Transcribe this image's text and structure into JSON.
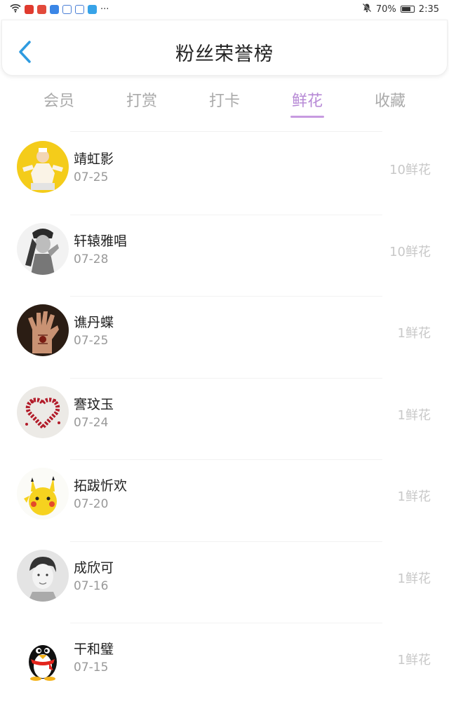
{
  "status_bar": {
    "battery": "70%",
    "time": "2:35",
    "dots": "···"
  },
  "header": {
    "title": "粉丝荣誉榜"
  },
  "tabs": [
    {
      "label": "会员"
    },
    {
      "label": "打赏"
    },
    {
      "label": "打卡"
    },
    {
      "label": "鲜花"
    },
    {
      "label": "收藏"
    }
  ],
  "active_tab": "鲜花",
  "fans": [
    {
      "name": "靖虹影",
      "date": "07-25",
      "amount": "10鲜花"
    },
    {
      "name": "轩辕雅唱",
      "date": "07-28",
      "amount": "10鲜花"
    },
    {
      "name": "谯丹蝶",
      "date": "07-25",
      "amount": "1鲜花"
    },
    {
      "name": "謇玟玉",
      "date": "07-24",
      "amount": "1鲜花"
    },
    {
      "name": "拓跋忻欢",
      "date": "07-20",
      "amount": "1鲜花"
    },
    {
      "name": "成欣可",
      "date": "07-16",
      "amount": "1鲜花"
    },
    {
      "name": "干和璧",
      "date": "07-15",
      "amount": "1鲜花"
    }
  ],
  "colors": {
    "accent": "#b78ad6",
    "back_arrow": "#2e9be0",
    "muted": "#999999"
  }
}
